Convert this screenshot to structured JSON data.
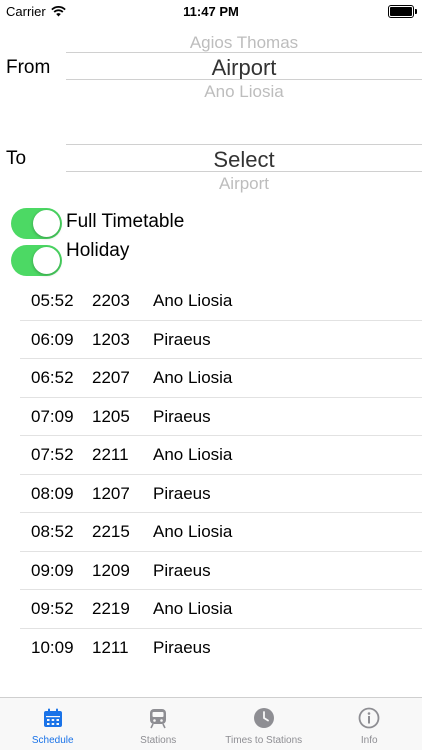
{
  "status": {
    "carrier": "Carrier",
    "time": "11:47 PM"
  },
  "from": {
    "label": "From",
    "above": "Agios Thomas",
    "selected": "Airport",
    "below": "Ano Liosia"
  },
  "to": {
    "label": "To",
    "selected": "Select",
    "below": "Airport"
  },
  "toggles": [
    {
      "label": "Full Timetable",
      "on": true
    },
    {
      "label": "Holiday",
      "on": true
    }
  ],
  "timetable": [
    {
      "time": "05:52",
      "train": "2203",
      "destination": "Ano Liosia"
    },
    {
      "time": "06:09",
      "train": "1203",
      "destination": "Piraeus"
    },
    {
      "time": "06:52",
      "train": "2207",
      "destination": "Ano Liosia"
    },
    {
      "time": "07:09",
      "train": "1205",
      "destination": "Piraeus"
    },
    {
      "time": "07:52",
      "train": "2211",
      "destination": "Ano Liosia"
    },
    {
      "time": "08:09",
      "train": "1207",
      "destination": "Piraeus"
    },
    {
      "time": "08:52",
      "train": "2215",
      "destination": "Ano Liosia"
    },
    {
      "time": "09:09",
      "train": "1209",
      "destination": "Piraeus"
    },
    {
      "time": "09:52",
      "train": "2219",
      "destination": "Ano Liosia"
    },
    {
      "time": "10:09",
      "train": "1211",
      "destination": "Piraeus"
    }
  ],
  "tabs": [
    {
      "label": "Schedule",
      "icon": "calendar-icon",
      "active": true
    },
    {
      "label": "Stations",
      "icon": "train-icon",
      "active": false
    },
    {
      "label": "Times to Stations",
      "icon": "clock-icon",
      "active": false
    },
    {
      "label": "Info",
      "icon": "info-icon",
      "active": false
    }
  ],
  "colors": {
    "accent": "#1a73e8",
    "toggle_on": "#4cd964",
    "tab_inactive": "#8e8e93"
  }
}
